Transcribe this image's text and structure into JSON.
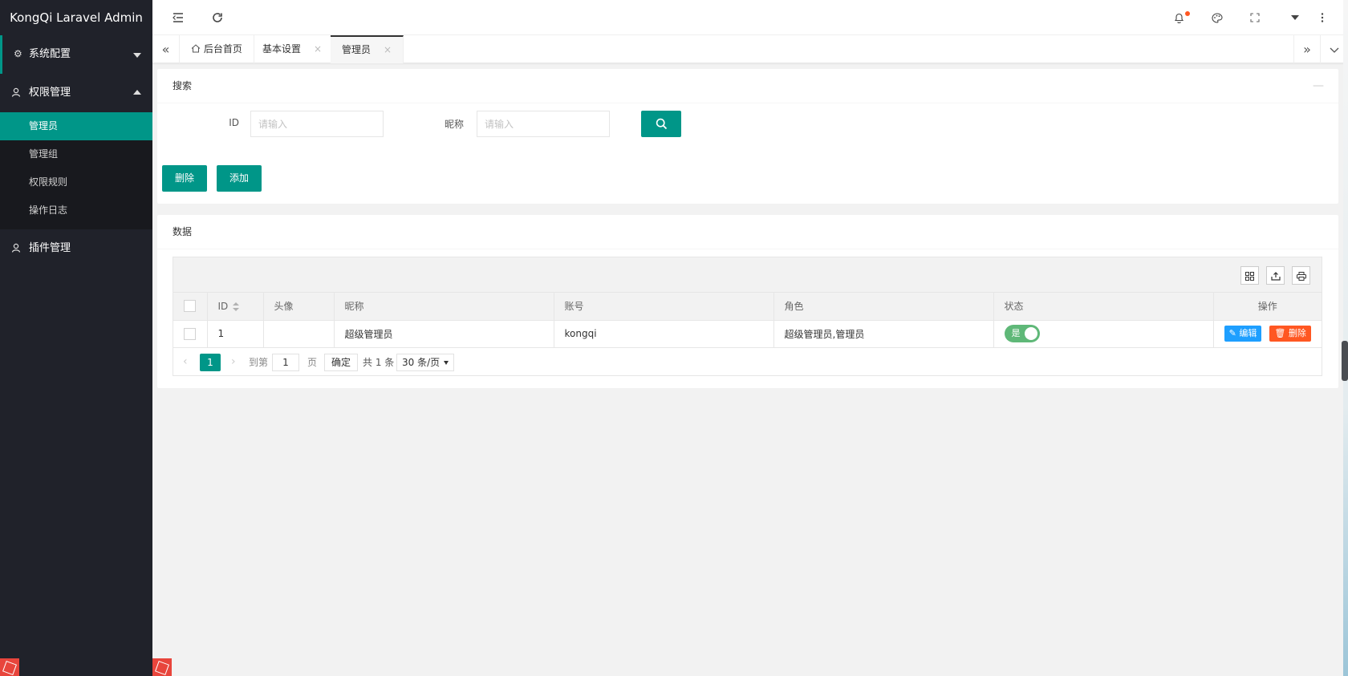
{
  "app": {
    "title": "KongQi Laravel Admin"
  },
  "sidebar": {
    "groups": [
      {
        "label": "系统配置",
        "icon": "gear-icon"
      },
      {
        "label": "权限管理",
        "icon": "user-icon"
      },
      {
        "label": "插件管理",
        "icon": "user-icon"
      }
    ],
    "sub_items": [
      "管理员",
      "管理组",
      "权限规则",
      "操作日志"
    ]
  },
  "header": {
    "icons": [
      "menu-fold-icon",
      "refresh-icon",
      "bell-icon",
      "theme-icon",
      "fullscreen-icon",
      "dropdown-icon",
      "more-icon"
    ]
  },
  "tabs": {
    "items": [
      {
        "label": "后台首页",
        "closable": false
      },
      {
        "label": "基本设置",
        "closable": true
      },
      {
        "label": "管理员",
        "closable": true,
        "active": true
      }
    ],
    "close_glyph": "×"
  },
  "search": {
    "title": "搜索",
    "fold_glyph": "—",
    "fields": [
      {
        "label": "ID",
        "placeholder": "请输入"
      },
      {
        "label": "昵称",
        "placeholder": "请输入"
      }
    ],
    "delete_label": "删除",
    "add_label": "添加"
  },
  "data_card": {
    "title": "数据",
    "columns": [
      "ID",
      "头像",
      "昵称",
      "账号",
      "角色",
      "状态",
      "操作"
    ],
    "rows": [
      {
        "id": "1",
        "avatar": "",
        "nickname": "超级管理员",
        "account": "kongqi",
        "role": "超级管理员,管理员",
        "status_text": "是",
        "status_on": true
      }
    ],
    "row_actions": {
      "edit": "编辑",
      "delete": "删除"
    }
  },
  "pager": {
    "current": "1",
    "goto_label": "到第",
    "goto_value": "1",
    "page_unit": "页",
    "confirm": "确定",
    "total": "共 1 条",
    "page_size": "30 条/页"
  },
  "colors": {
    "primary": "#009688",
    "sidebar_bg": "#20222a",
    "edit": "#1E9FFF",
    "danger": "#FF5722",
    "switch_on": "#5FB878"
  }
}
